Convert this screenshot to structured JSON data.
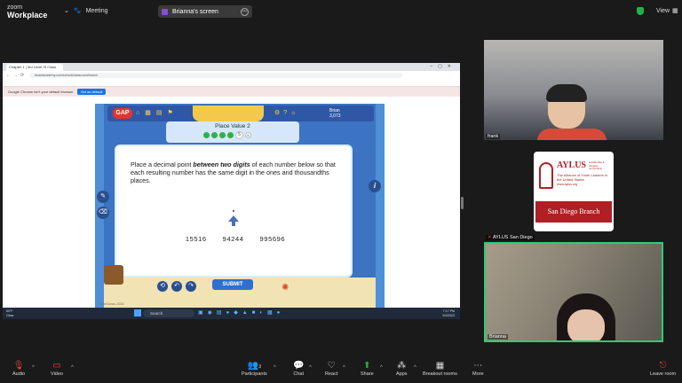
{
  "app": {
    "logo_line1": "zoom",
    "logo_line2": "Workplace",
    "meeting_label": "Meeting"
  },
  "share": {
    "label": "Brianna's screen"
  },
  "header": {
    "view_label": "View"
  },
  "browser": {
    "tab_title": "Chapter 1 | 3rd Level IS Class",
    "url": "beastacademy.com/school/classroom/lesson",
    "bookmarks": "",
    "infobar_text": "Google Chrome isn't your default browser",
    "infobar_button": "Set as default"
  },
  "game": {
    "logo": "GAP",
    "user_name": "Brian",
    "user_score": "3,073",
    "title": "Place Value 2",
    "current_step": "5",
    "next_step": "6",
    "question_prefix": "Place a decimal point ",
    "question_emphasis": "between two digits",
    "question_suffix": " of each number below so that each resulting number has the same digit in the ones and thousandths places.",
    "numbers": [
      "15516",
      "94244",
      "995696"
    ],
    "submit_label": "SUBMIT",
    "footer": "CuriOcean, 2023"
  },
  "taskbar": {
    "weather_temp": "60°F",
    "weather_desc": "Clear",
    "search_placeholder": "Search",
    "time": "7:17 PM",
    "date": "3/4/2023"
  },
  "participants": {
    "tile1_name": "frank",
    "tile2_name": "AYLUS San Diego",
    "tile3_name": "Brianna",
    "aylus_name": "AYLUS",
    "aylus_tagline": "Leadership & Integrity Community",
    "aylus_full": "The Alliance of Youth Leaders in the United States",
    "aylus_site": "www.aylus.org",
    "aylus_branch": "San Diego Branch"
  },
  "toolbar": {
    "audio": "Audio",
    "video": "Video",
    "participants": "Participants",
    "participants_count": "3",
    "chat": "Chat",
    "react": "React",
    "share": "Share",
    "apps": "Apps",
    "breakout": "Breakout rooms",
    "more": "More",
    "leave": "Leave room"
  },
  "colors": {
    "accent_green": "#23b04b",
    "mute_red": "#e8413d",
    "aylus_red": "#b01f24",
    "game_blue": "#3c73c2"
  }
}
